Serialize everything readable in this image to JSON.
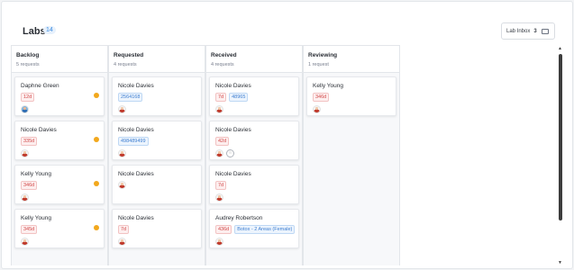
{
  "header": {
    "title": "Labs",
    "count": "14",
    "inbox_label": "Lab Inbox",
    "inbox_count": "3"
  },
  "columns": [
    {
      "title": "Backlog",
      "sub": "5 requests",
      "cards": [
        {
          "name": "Daphne Green",
          "tags": [
            {
              "text": "12d",
              "kind": "red"
            }
          ],
          "dot": true
        },
        {
          "name": "Nicole Davies",
          "tags": [
            {
              "text": "335d",
              "kind": "red"
            }
          ],
          "dot": true
        },
        {
          "name": "Kelly Young",
          "tags": [
            {
              "text": "346d",
              "kind": "red"
            }
          ],
          "dot": true
        },
        {
          "name": "Kelly Young",
          "tags": [
            {
              "text": "345d",
              "kind": "red"
            }
          ],
          "dot": true
        }
      ]
    },
    {
      "title": "Requested",
      "sub": "4 requests",
      "cards": [
        {
          "name": "Nicole Davies",
          "tags": [
            {
              "text": "2564168",
              "kind": "blue"
            }
          ]
        },
        {
          "name": "Nicole Davies",
          "tags": [
            {
              "text": "498489499",
              "kind": "blue"
            }
          ]
        },
        {
          "name": "Nicole Davies",
          "tags": []
        },
        {
          "name": "Nicole Davies",
          "tags": [
            {
              "text": "7d",
              "kind": "red"
            }
          ]
        }
      ]
    },
    {
      "title": "Received",
      "sub": "4 requests",
      "cards": [
        {
          "name": "Nicole Davies",
          "tags": [
            {
              "text": "7d",
              "kind": "red"
            },
            {
              "text": "48965",
              "kind": "blue"
            }
          ]
        },
        {
          "name": "Nicole Davies",
          "tags": [
            {
              "text": "42d",
              "kind": "red"
            }
          ]
        },
        {
          "name": "Nicole Davies",
          "tags": [
            {
              "text": "7d",
              "kind": "red"
            }
          ]
        },
        {
          "name": "Audrey Robertson",
          "tags": [
            {
              "text": "436d",
              "kind": "red"
            },
            {
              "text": "Botox - 2 Areas (Female)",
              "kind": "blue"
            }
          ]
        }
      ]
    },
    {
      "title": "Reviewing",
      "sub": "1 request",
      "cards": [
        {
          "name": "Kelly Young",
          "tags": [
            {
              "text": "346d",
              "kind": "red"
            }
          ]
        }
      ]
    }
  ]
}
